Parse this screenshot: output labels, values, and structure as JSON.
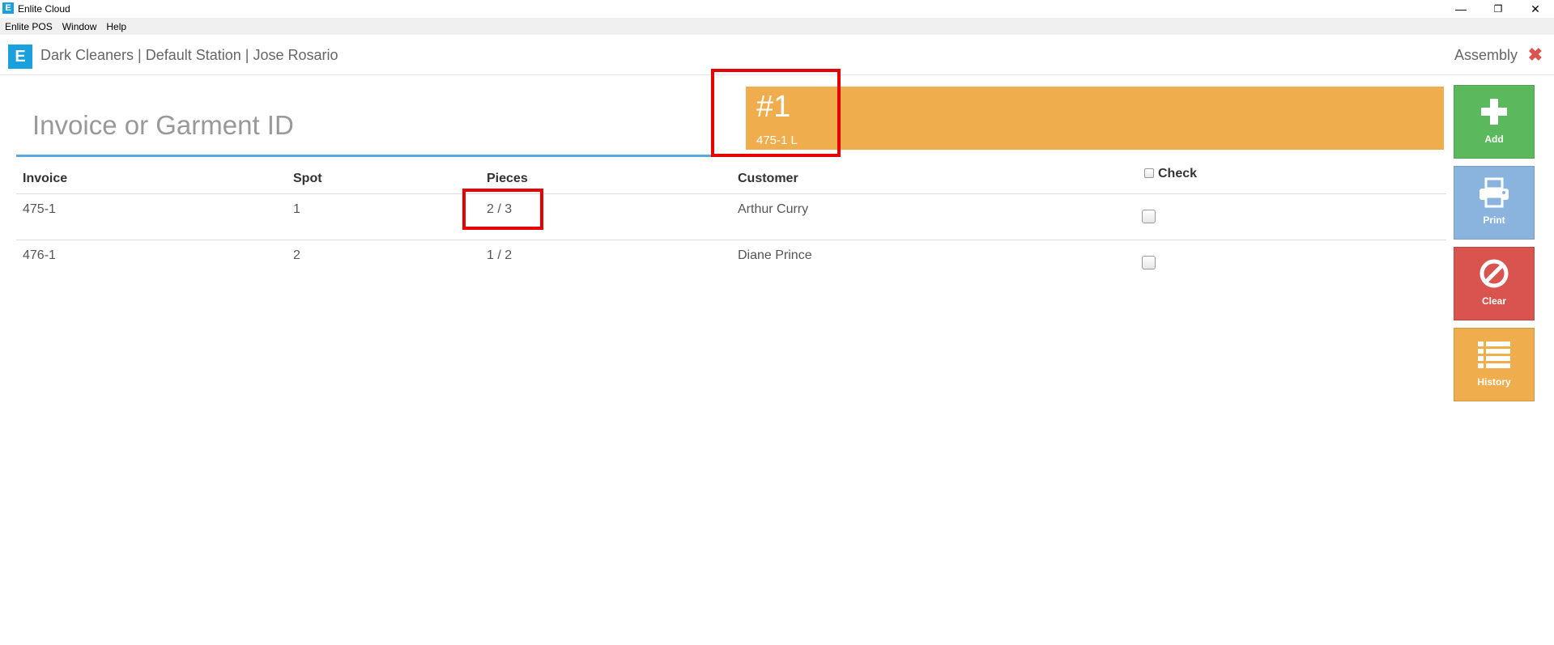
{
  "window": {
    "title": "Enlite Cloud",
    "app_icon": "E",
    "minimize": "—",
    "maximize": "❐",
    "close": "✕"
  },
  "menu": [
    "Enlite POS",
    "Window",
    "Help"
  ],
  "header": {
    "logo": "E",
    "breadcrumb": "Dark Cleaners | Default Station | Jose Rosario",
    "mode": "Assembly",
    "close": "✖"
  },
  "search": {
    "placeholder": "Invoice or Garment ID",
    "value": ""
  },
  "banner": {
    "number": "#1",
    "detail": "475-1 L",
    "color": "#f0ad4e"
  },
  "table": {
    "headers": {
      "invoice": "Invoice",
      "spot": "Spot",
      "pieces": "Pieces",
      "customer": "Customer",
      "check": "Check"
    },
    "rows": [
      {
        "invoice": "475-1",
        "spot": "1",
        "pieces": "2 / 3",
        "customer": "Arthur Curry",
        "checked": false
      },
      {
        "invoice": "476-1",
        "spot": "2",
        "pieces": "1 / 2",
        "customer": "Diane Prince",
        "checked": false
      }
    ]
  },
  "actions": [
    {
      "label": "Add",
      "icon": "plus-icon",
      "color": "#5cb85c"
    },
    {
      "label": "Print",
      "icon": "printer-icon",
      "color": "#8ab4de"
    },
    {
      "label": "Clear",
      "icon": "ban-icon",
      "color": "#d9534f"
    },
    {
      "label": "History",
      "icon": "list-icon",
      "color": "#f0ad4e"
    }
  ],
  "highlight_color": "#e60000"
}
